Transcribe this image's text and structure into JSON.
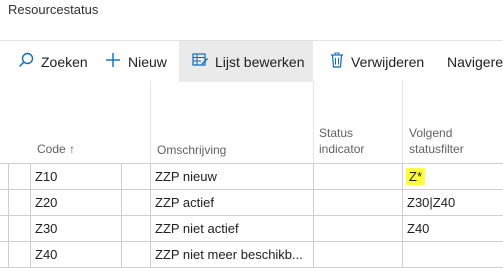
{
  "page": {
    "title": "Resourcestatus"
  },
  "toolbar": {
    "search_label": "Zoeken",
    "new_label": "Nieuw",
    "edit_list_label": "Lijst bewerken",
    "delete_label": "Verwijderen",
    "navigate_label": "Navigere"
  },
  "columns": {
    "code": "Code ↑",
    "description": "Omschrijving",
    "status_indicator_line1": "Status",
    "status_indicator_line2": "indicator",
    "next_filter_line1": "Volgend",
    "next_filter_line2": "statusfilter"
  },
  "rows": [
    {
      "code": "Z10",
      "description": "ZZP nieuw",
      "indicator": "",
      "next_filter": "Z*"
    },
    {
      "code": "Z20",
      "description": "ZZP actief",
      "indicator": "",
      "next_filter": "Z30|Z40"
    },
    {
      "code": "Z30",
      "description": "ZZP niet actief",
      "indicator": "",
      "next_filter": "Z40"
    },
    {
      "code": "Z40",
      "description": "ZZP niet meer beschikb...",
      "indicator": "",
      "next_filter": ""
    }
  ],
  "colors": {
    "accent": "#0f6cbd",
    "highlight": "#ffff40",
    "active_button": "#eaeaea"
  },
  "icons": {
    "search": "search-icon",
    "new": "plus-icon",
    "edit_list": "edit-list-icon",
    "delete": "trash-icon"
  }
}
